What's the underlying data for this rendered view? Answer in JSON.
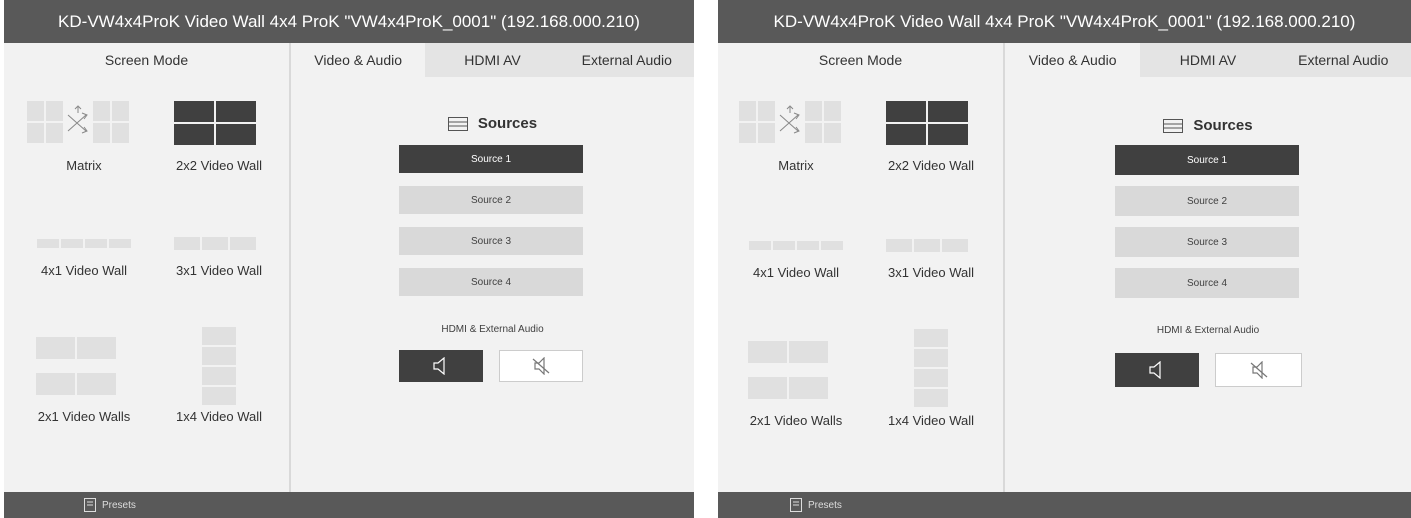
{
  "window": {
    "title": "KD-VW4x4ProK Video Wall 4x4 ProK \"VW4x4ProK_0001\" (192.168.000.210)"
  },
  "screen_mode": {
    "header": "Screen Mode",
    "modes": [
      {
        "label": "Matrix",
        "icon": "matrix-icon"
      },
      {
        "label": "2x2 Video Wall",
        "icon": "video-wall-2x2-icon"
      },
      {
        "label": "4x1 Video Wall",
        "icon": "video-wall-4x1-icon"
      },
      {
        "label": "3x1 Video Wall",
        "icon": "video-wall-3x1-icon"
      },
      {
        "label": "2x1 Video Walls",
        "icon": "video-walls-2x1-icon"
      },
      {
        "label": "1x4 Video Wall",
        "icon": "video-wall-1x4-icon"
      }
    ]
  },
  "tabs": [
    {
      "label": "Video & Audio",
      "active": true
    },
    {
      "label": "HDMI AV",
      "active": false
    },
    {
      "label": "External Audio",
      "active": false
    }
  ],
  "sources": {
    "header": "Sources",
    "icon": "sources-list-icon",
    "items": [
      "Source 1",
      "Source 2",
      "Source 3",
      "Source 4"
    ],
    "selected": "Source 1"
  },
  "audio": {
    "label": "HDMI & External Audio",
    "unmute_icon": "speaker-icon",
    "mute_icon": "speaker-muted-icon",
    "state": "unmuted"
  },
  "footer": {
    "presets_label": "Presets",
    "presets_icon": "presets-icon"
  },
  "colors": {
    "title_bar": "#595959",
    "selected": "#404040",
    "button": "#d9d9d9",
    "background": "#f2f2f2"
  }
}
